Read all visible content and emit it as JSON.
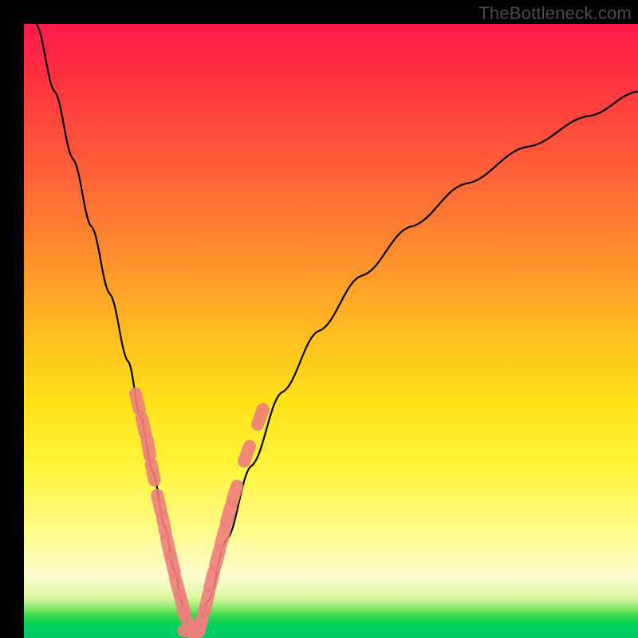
{
  "watermark": "TheBottleneck.com",
  "chart_data": {
    "type": "line",
    "title": "",
    "xlabel": "",
    "ylabel": "",
    "xlim": [
      0,
      100
    ],
    "ylim": [
      0,
      100
    ],
    "series": [
      {
        "name": "bottleneck-curve",
        "x": [
          2,
          5,
          8,
          11,
          14,
          17,
          19,
          21,
          23,
          24.5,
          26,
          27,
          28,
          30,
          33,
          37,
          42,
          48,
          55,
          63,
          72,
          82,
          92,
          100
        ],
        "y": [
          100,
          89,
          78,
          67,
          56,
          45,
          36,
          27,
          18,
          11,
          5,
          1,
          1,
          6,
          16,
          28,
          40,
          50,
          59,
          67,
          74,
          80,
          85,
          89
        ]
      }
    ],
    "markers": {
      "name": "highlight-segments",
      "color": "#ef7f7d",
      "points": [
        {
          "x": 18.5,
          "y": 38.5
        },
        {
          "x": 19.5,
          "y": 34.5
        },
        {
          "x": 20.3,
          "y": 31.0
        },
        {
          "x": 21.0,
          "y": 27.0
        },
        {
          "x": 22.0,
          "y": 22.0
        },
        {
          "x": 22.8,
          "y": 18.5
        },
        {
          "x": 23.5,
          "y": 15.0
        },
        {
          "x": 24.2,
          "y": 12.0
        },
        {
          "x": 25.0,
          "y": 8.5
        },
        {
          "x": 25.8,
          "y": 5.5
        },
        {
          "x": 26.5,
          "y": 3.0
        },
        {
          "x": 27.3,
          "y": 1.2
        },
        {
          "x": 28.2,
          "y": 1.2
        },
        {
          "x": 29.0,
          "y": 3.0
        },
        {
          "x": 29.8,
          "y": 6.0
        },
        {
          "x": 30.6,
          "y": 9.5
        },
        {
          "x": 31.5,
          "y": 13.0
        },
        {
          "x": 32.4,
          "y": 16.5
        },
        {
          "x": 33.3,
          "y": 20.0
        },
        {
          "x": 34.3,
          "y": 23.5
        },
        {
          "x": 36.3,
          "y": 30.0
        },
        {
          "x": 38.5,
          "y": 36.0
        }
      ]
    }
  }
}
